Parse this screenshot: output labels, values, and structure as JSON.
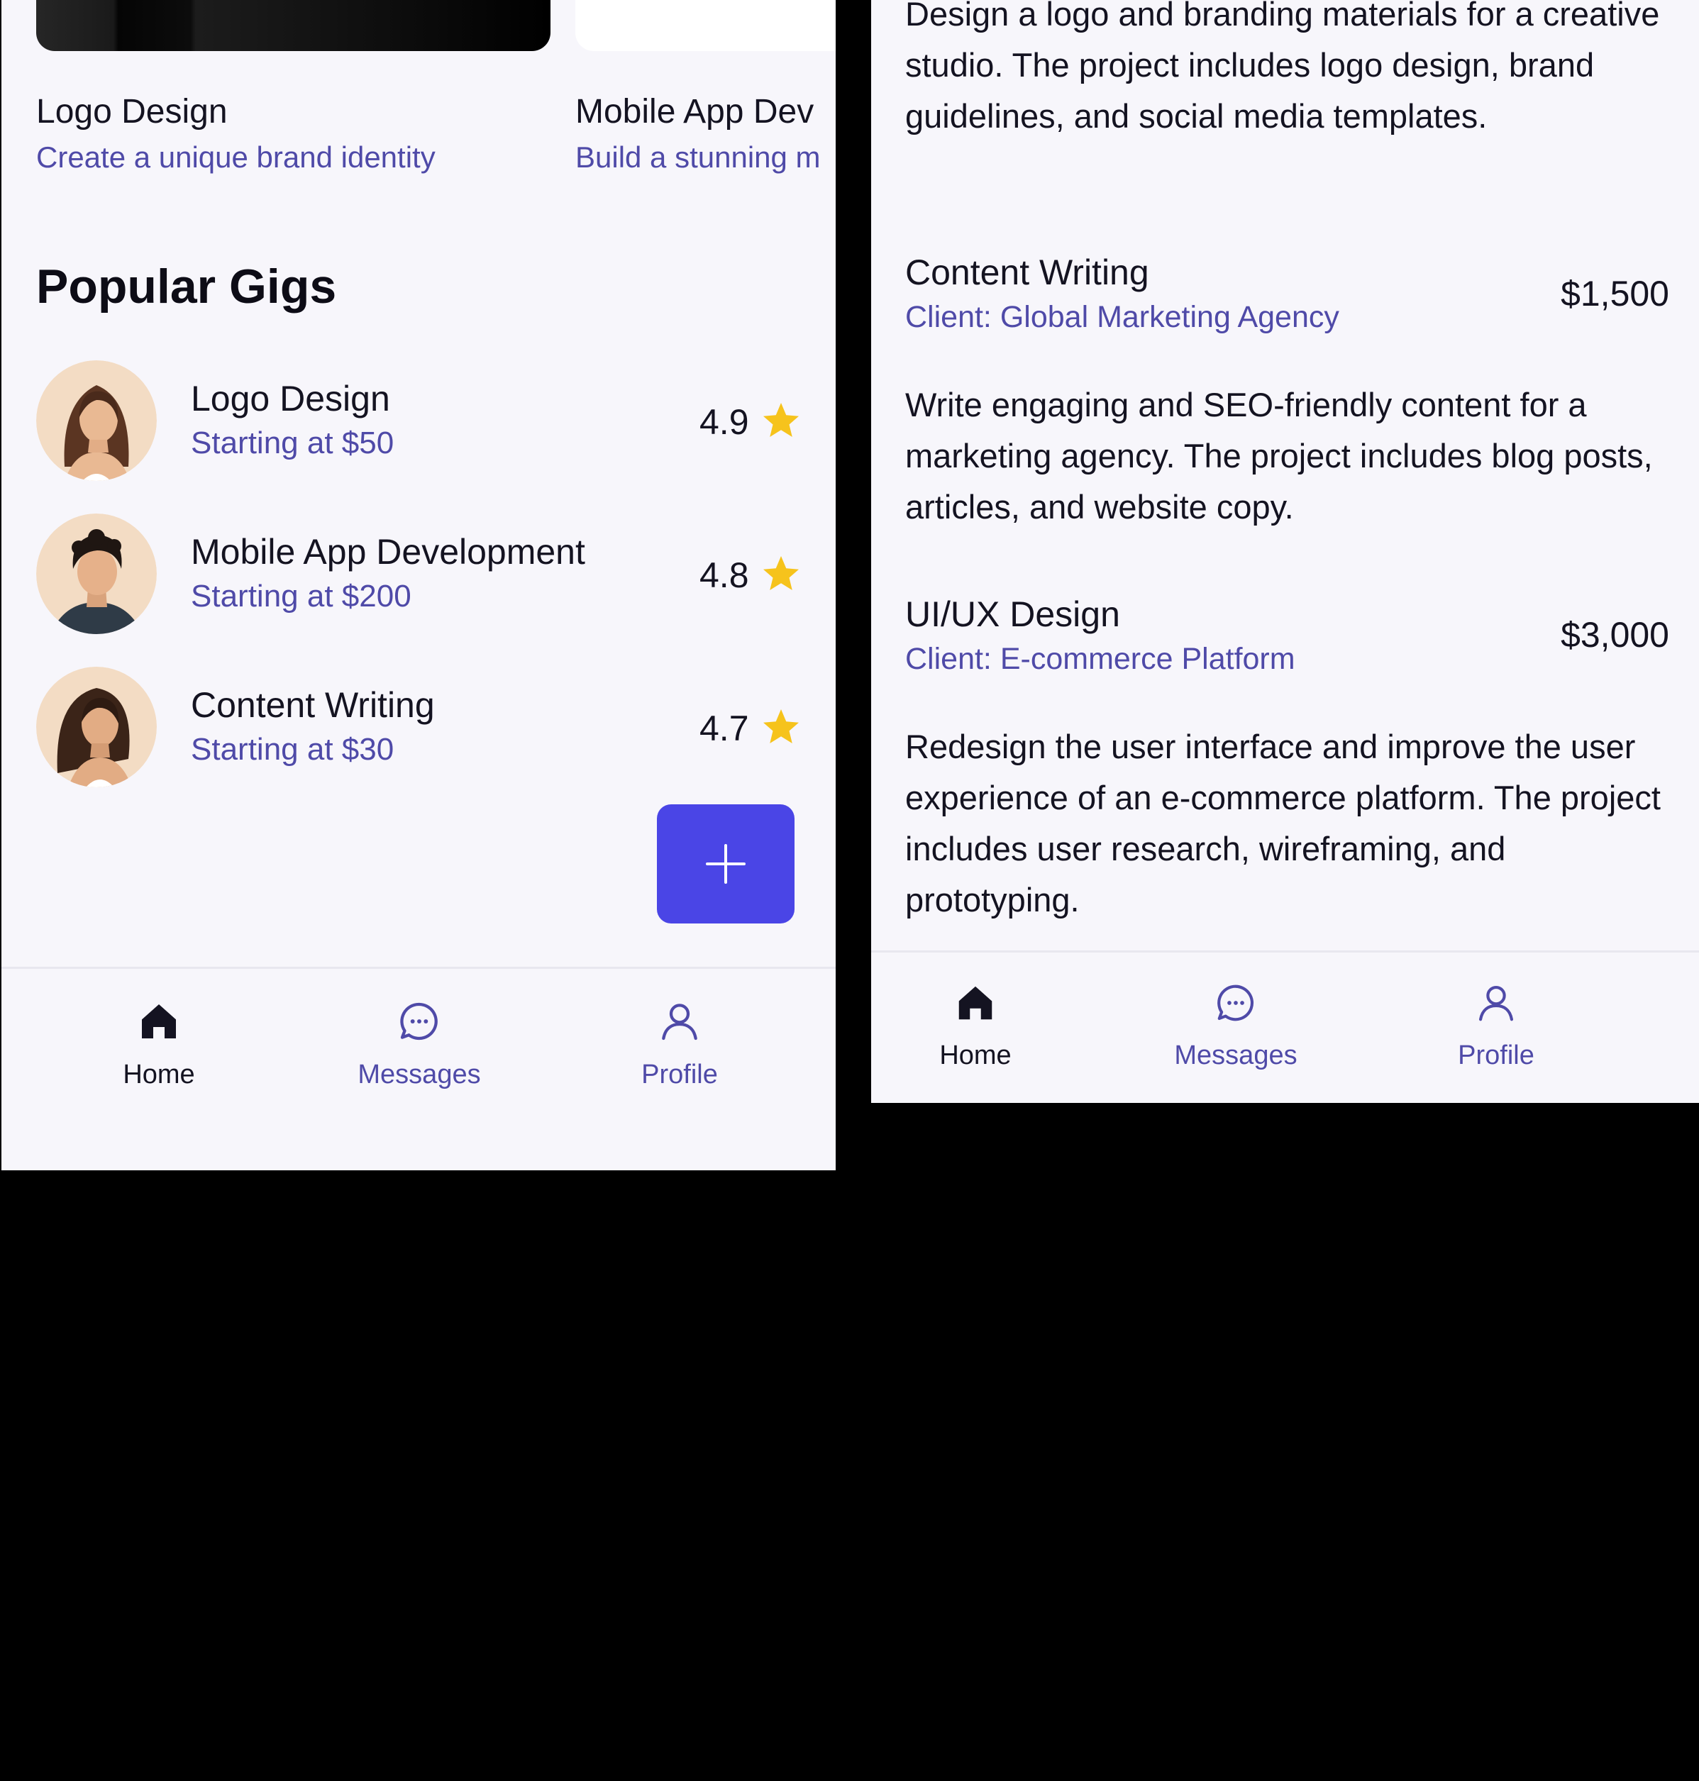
{
  "left_screen": {
    "featured_cards": [
      {
        "title": "Logo Design",
        "subtitle": "Create a unique brand identity"
      },
      {
        "title": "Mobile App Dev",
        "subtitle": "Build a stunning m"
      }
    ],
    "section_title": "Popular Gigs",
    "gigs": [
      {
        "name": "Logo Design",
        "price": "Starting at $50",
        "rating": "4.9"
      },
      {
        "name": "Mobile App Development",
        "price": "Starting at $200",
        "rating": "4.8"
      },
      {
        "name": "Content Writing",
        "price": "Starting at $30",
        "rating": "4.7"
      }
    ],
    "fab_icon": "plus-icon",
    "nav": [
      {
        "label": "Home",
        "icon": "home-icon",
        "active": true
      },
      {
        "label": "Messages",
        "icon": "chat-icon",
        "active": false
      },
      {
        "label": "Profile",
        "icon": "user-icon",
        "active": false
      }
    ]
  },
  "right_screen": {
    "intro_description": "Design a logo and branding materials for a creative studio. The project includes logo design, brand guidelines, and social media templates.",
    "projects": [
      {
        "title": "Content Writing",
        "client": "Client: Global Marketing Agency",
        "budget": "$1,500",
        "description": "Write engaging and SEO-friendly content for a marketing agency. The project includes blog posts, articles, and website copy."
      },
      {
        "title": "UI/UX Design",
        "client": "Client: E-commerce Platform",
        "budget": "$3,000",
        "description": "Redesign the user interface and improve the user experience of an e-commerce platform. The project includes user research, wireframing, and prototyping."
      }
    ],
    "nav": [
      {
        "label": "Home",
        "icon": "home-icon",
        "active": true
      },
      {
        "label": "Messages",
        "icon": "chat-icon",
        "active": false
      },
      {
        "label": "Profile",
        "icon": "user-icon",
        "active": false
      }
    ]
  },
  "colors": {
    "accent": "#4a45e6",
    "link": "#4f4aa8",
    "text": "#141321",
    "surface": "#f7f6fb",
    "star": "#f6c31c",
    "backdrop": "#000000"
  }
}
